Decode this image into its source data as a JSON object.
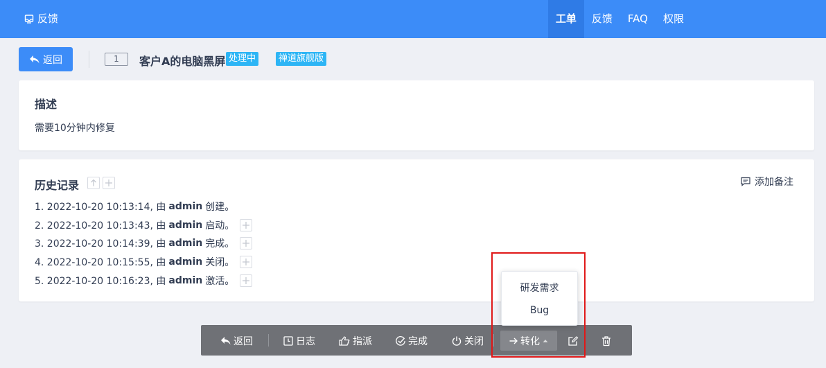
{
  "header": {
    "brand_icon": "feedback-icon",
    "brand_label": "反馈",
    "nav": [
      {
        "label": "工单",
        "active": true
      },
      {
        "label": "反馈",
        "active": false
      },
      {
        "label": "FAQ",
        "active": false
      },
      {
        "label": "权限",
        "active": false
      }
    ]
  },
  "title_row": {
    "back_label": "返回",
    "ticket_id": "1",
    "title": "客户A的电脑黑屏",
    "status_badge": "处理中",
    "product_badge": "禅道旗舰版"
  },
  "description": {
    "heading": "描述",
    "body": "需要10分钟内修复"
  },
  "history": {
    "heading": "历史记录",
    "add_note_label": "添加备注",
    "entries": [
      {
        "prefix": "1. 2022-10-20 10:13:14, 由",
        "user": "admin",
        "action": "创建。",
        "expandable": false
      },
      {
        "prefix": "2. 2022-10-20 10:13:43, 由",
        "user": "admin",
        "action": "启动。",
        "expandable": true
      },
      {
        "prefix": "3. 2022-10-20 10:14:39, 由",
        "user": "admin",
        "action": "完成。",
        "expandable": true
      },
      {
        "prefix": "4. 2022-10-20 10:15:55, 由",
        "user": "admin",
        "action": "关闭。",
        "expandable": true
      },
      {
        "prefix": "5. 2022-10-20 10:16:23, 由",
        "user": "admin",
        "action": "激活。",
        "expandable": true
      }
    ]
  },
  "toolbar": {
    "back": "返回",
    "log": "日志",
    "assign": "指派",
    "finish": "完成",
    "close": "关闭",
    "convert": "转化"
  },
  "convert_menu": {
    "options": [
      "研发需求",
      "Bug"
    ]
  },
  "colors": {
    "primary": "#3c8cf8",
    "badge": "#2db5f5",
    "toolbar_bg": "#6f7176",
    "highlight": "#e01818"
  }
}
